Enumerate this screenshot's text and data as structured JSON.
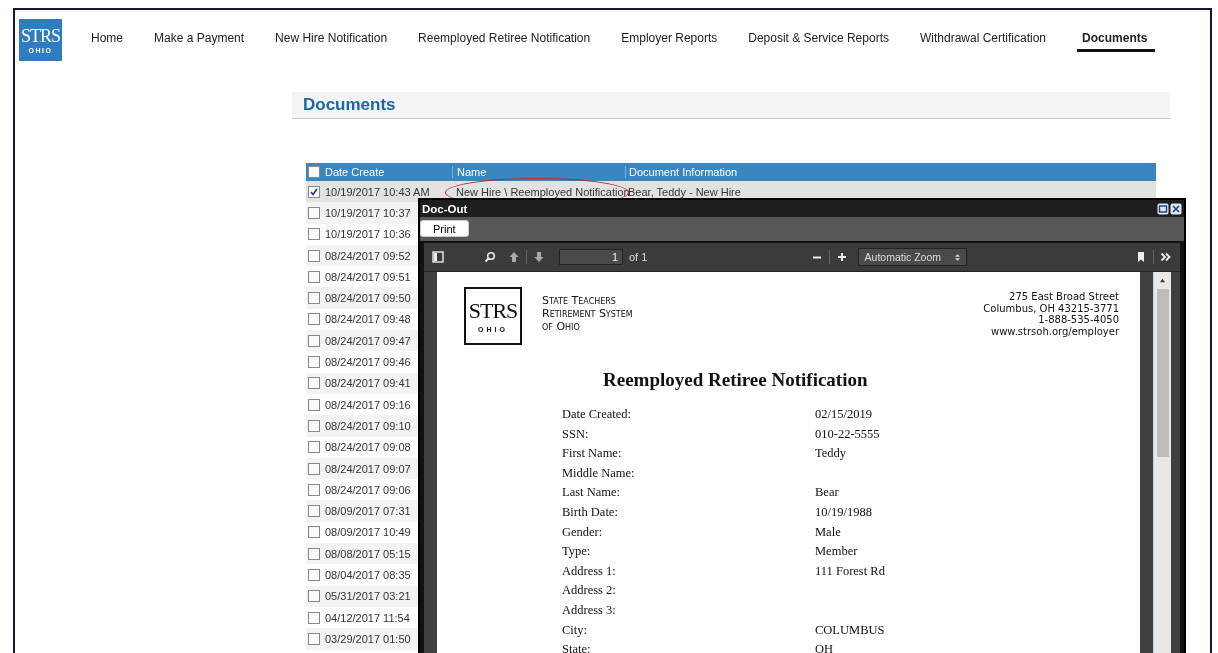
{
  "logo": {
    "mark": "STRS",
    "sub": "OHIO"
  },
  "doc_logo": {
    "mark": "STRS",
    "sub": "OHIO"
  },
  "nav": [
    {
      "label": "Home",
      "selected": false
    },
    {
      "label": "Make a Payment",
      "selected": false
    },
    {
      "label": "New Hire Notification",
      "selected": false
    },
    {
      "label": "Reemployed Retiree Notification",
      "selected": false
    },
    {
      "label": "Employer Reports",
      "selected": false
    },
    {
      "label": "Deposit & Service Reports",
      "selected": false
    },
    {
      "label": "Withdrawal Certification",
      "selected": false
    },
    {
      "label": "Documents",
      "selected": true
    }
  ],
  "page_title": "Documents",
  "table": {
    "select_all_checked": false,
    "columns": [
      "Date Create",
      "Name",
      "Document Information"
    ],
    "rows": [
      {
        "date": "10/19/2017 10:43 AM",
        "name": "New Hire \\ Reemployed Notification",
        "info": "Bear, Teddy - New Hire",
        "checked": true,
        "selected": true
      },
      {
        "date": "10/19/2017 10:37",
        "checked": false,
        "selected": false
      },
      {
        "date": "10/19/2017 10:36",
        "checked": false,
        "selected": false
      },
      {
        "date": "08/24/2017 09:52",
        "checked": false,
        "selected": false
      },
      {
        "date": "08/24/2017 09:51",
        "checked": false,
        "selected": false
      },
      {
        "date": "08/24/2017 09:50",
        "checked": false,
        "selected": false
      },
      {
        "date": "08/24/2017 09:48",
        "checked": false,
        "selected": false
      },
      {
        "date": "08/24/2017 09:47",
        "checked": false,
        "selected": false
      },
      {
        "date": "08/24/2017 09:46",
        "checked": false,
        "selected": false
      },
      {
        "date": "08/24/2017 09:41",
        "checked": false,
        "selected": false
      },
      {
        "date": "08/24/2017 09:16",
        "checked": false,
        "selected": false
      },
      {
        "date": "08/24/2017 09:10",
        "checked": false,
        "selected": false
      },
      {
        "date": "08/24/2017 09:08",
        "checked": false,
        "selected": false
      },
      {
        "date": "08/24/2017 09:07",
        "checked": false,
        "selected": false
      },
      {
        "date": "08/24/2017 09:06",
        "checked": false,
        "selected": false
      },
      {
        "date": "08/09/2017 07:31",
        "checked": false,
        "selected": false
      },
      {
        "date": "08/09/2017 10:49",
        "checked": false,
        "selected": false
      },
      {
        "date": "08/08/2017 05:15",
        "checked": false,
        "selected": false
      },
      {
        "date": "08/04/2017 08:35",
        "checked": false,
        "selected": false
      },
      {
        "date": "05/31/2017 03:21",
        "checked": false,
        "selected": false
      },
      {
        "date": "04/12/2017 11:54",
        "checked": false,
        "selected": false
      },
      {
        "date": "03/29/2017 01:50",
        "checked": false,
        "selected": false
      }
    ]
  },
  "dialog": {
    "title": "Doc-Out",
    "print_button": "Print",
    "viewer": {
      "page": "1",
      "page_count": "of 1",
      "zoom": "Automatic Zoom"
    },
    "document": {
      "org_lines": [
        "State Teachers",
        "Retirement System",
        "of Ohio"
      ],
      "address_lines": [
        "275 East Broad Street",
        "Columbus, OH 43215-3771",
        "1-888-535-4050",
        "www.strsoh.org/employer"
      ],
      "heading": "Reemployed Retiree Notification",
      "fields": [
        {
          "label": "Date Created:",
          "value": "02/15/2019"
        },
        {
          "label": "SSN:",
          "value": "010-22-5555"
        },
        {
          "label": "First Name:",
          "value": "Teddy"
        },
        {
          "label": "Middle Name:"
        },
        {
          "label": "Last Name:",
          "value": "Bear"
        },
        {
          "label": "Birth Date:",
          "value": "10/19/1988"
        },
        {
          "label": "Gender:",
          "value": "Male"
        },
        {
          "label": "Type:",
          "value": "Member"
        },
        {
          "label": "Address 1:",
          "value": "111 Forest Rd"
        },
        {
          "label": "Address 2:"
        },
        {
          "label": "Address 3:"
        },
        {
          "label": "City:",
          "value": "COLUMBUS"
        },
        {
          "label": "State:",
          "value": "OH"
        }
      ]
    }
  }
}
